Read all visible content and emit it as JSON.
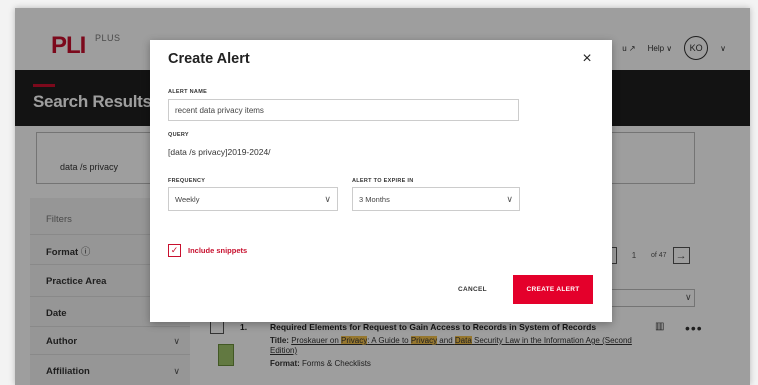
{
  "header": {
    "logo_text": "PLI",
    "logo_sup": "PLUS",
    "nav_partial": "u ↗",
    "help_label": "Help",
    "avatar_initials": "KO"
  },
  "page": {
    "title": "Search Results",
    "search_value": "data /s privacy"
  },
  "sidebar": {
    "filters_label": "Filters",
    "items": [
      {
        "label": "Format"
      },
      {
        "label": "Practice Area"
      },
      {
        "label": "Date"
      },
      {
        "label": "Author"
      },
      {
        "label": "Affiliation"
      }
    ]
  },
  "pager": {
    "prev_icon": "←",
    "current_page": "1",
    "of_label": "of 47",
    "next_icon": "→"
  },
  "result": {
    "number": "1.",
    "title": "Required Elements for Request to Gain Access to Records in System of Records",
    "title_prefix": "Title:",
    "book_title_a": "Proskauer on ",
    "hl1": "Privacy",
    "book_title_b": ": A Guide to ",
    "hl2": "Privacy",
    "book_title_c": " and ",
    "hl3": "Data",
    "book_title_d": " Security Law in the Information Age (Second",
    "book_title_e": "Edition)",
    "format_prefix": "Format:",
    "format_value": "Forms & Checklists"
  },
  "modal": {
    "title": "Create Alert",
    "close_icon": "×",
    "alert_name_label": "ALERT NAME",
    "alert_name_value": "recent data privacy items",
    "query_label": "QUERY",
    "query_value": "[data /s privacy]2019-2024/",
    "frequency_label": "FREQUENCY",
    "frequency_value": "Weekly",
    "expire_label": "ALERT TO EXPIRE IN",
    "expire_value": "3 Months",
    "include_snippets_label": "Include snippets",
    "include_snippets_checked": true,
    "cancel_label": "CANCEL",
    "create_label": "CREATE ALERT"
  },
  "colors": {
    "brand_red": "#c8102e",
    "button_red": "#e4002b",
    "highlight": "#f4c24d",
    "dark_band": "#1f1f1f"
  }
}
